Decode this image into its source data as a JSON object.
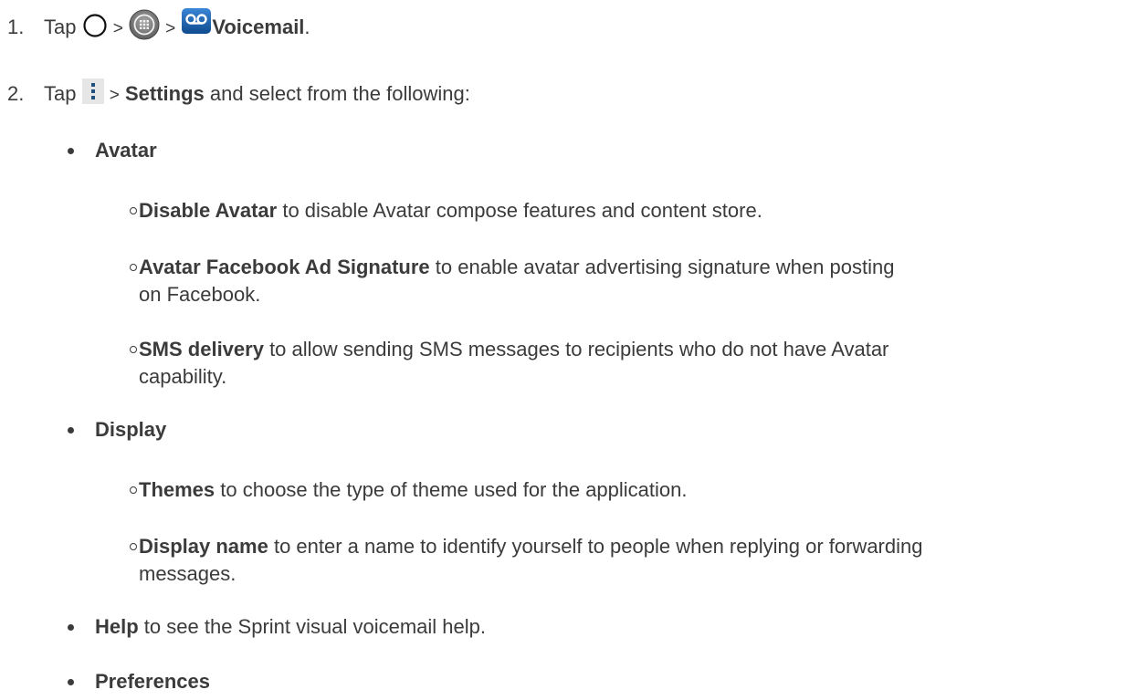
{
  "steps": [
    {
      "number": "1.",
      "tap": "Tap",
      "sep1": ">",
      "sep2": ">",
      "target": "Voicemail",
      "end": ".",
      "icons": [
        "home-circle-icon",
        "apps-grid-icon",
        "voicemail-app-icon"
      ]
    },
    {
      "number": "2.",
      "tap": "Tap",
      "sep": ">",
      "target": "Settings",
      "rest": "and select from the following:",
      "icons": [
        "overflow-menu-icon"
      ]
    }
  ],
  "groups": {
    "avatar": {
      "title": "Avatar",
      "items": [
        {
          "term": "Disable Avatar",
          "desc": " to disable Avatar compose features and content store."
        },
        {
          "term": "Avatar Facebook Ad Signature",
          "desc": " to enable avatar advertising signature when posting",
          "desc2": "on Facebook."
        },
        {
          "term": "SMS delivery",
          "desc": " to allow sending SMS messages to recipients who do not have Avatar",
          "desc2": "capability."
        }
      ]
    },
    "display": {
      "title": "Display",
      "items": [
        {
          "term": "Themes",
          "desc": " to choose the type of theme used for the application."
        },
        {
          "term": "Display name",
          "desc": " to enter a name to identify yourself to people when replying or forwarding",
          "desc2": "messages."
        }
      ]
    },
    "help": {
      "term": "Help",
      "desc": " to see the Sprint visual voicemail help."
    },
    "preferences": {
      "title": "Preferences"
    }
  },
  "colors": {
    "text": "#3b3b3b",
    "voicemail_icon_bg": "#1b5fa8",
    "apps_icon_bg": "#7a7a7a",
    "menu_icon_bg": "#e6e6e6"
  }
}
